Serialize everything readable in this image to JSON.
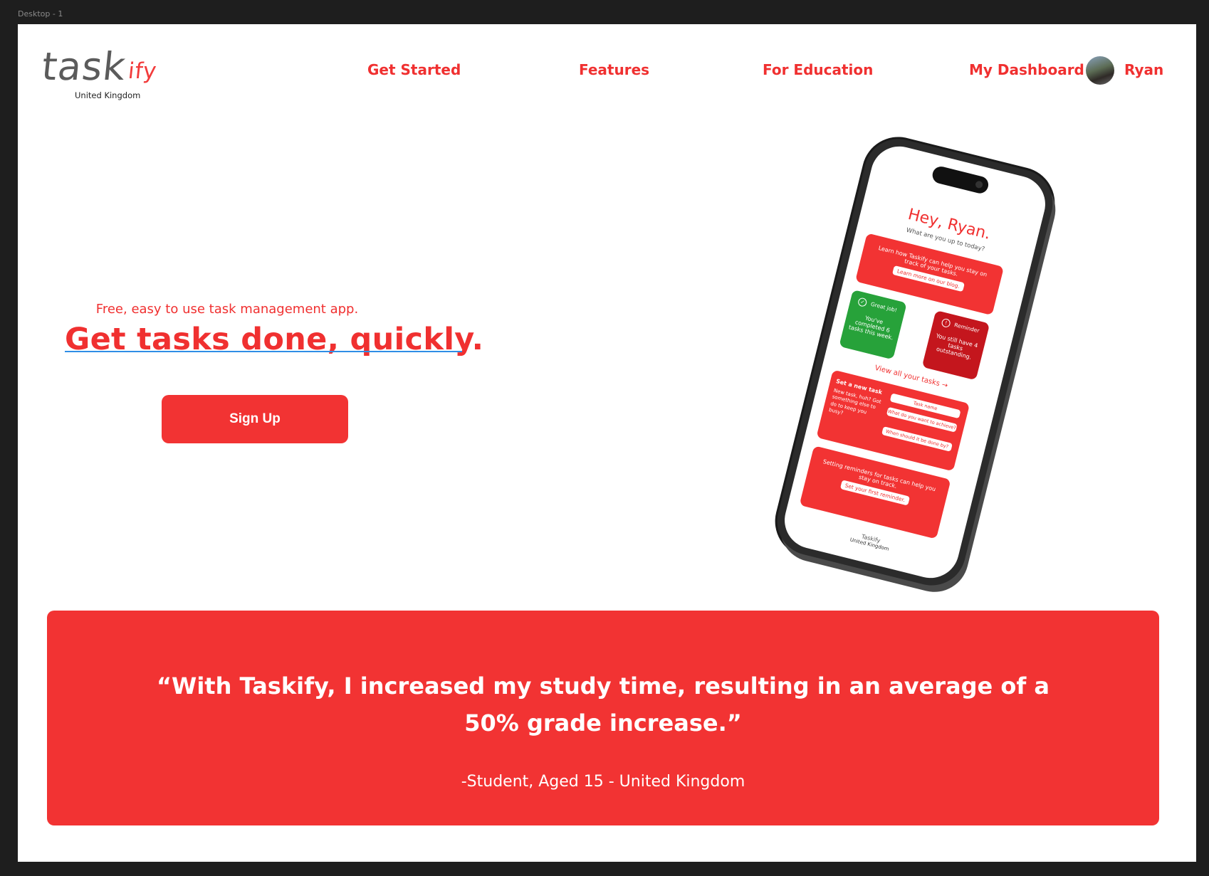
{
  "canvas": {
    "frame_label": "Desktop - 1"
  },
  "logo": {
    "part1": "task",
    "part2": "ify",
    "region": "United Kingdom"
  },
  "nav": {
    "get_started": "Get Started",
    "features": "Features",
    "for_education": "For Education",
    "dashboard": "My Dashboard",
    "user_name": "Ryan"
  },
  "hero": {
    "tagline": "Free, easy to use task management app.",
    "headline": "Get tasks done, quickly.",
    "signup": "Sign Up"
  },
  "phone": {
    "greeting": "Hey, Ryan.",
    "subtitle": "What are you up to today?",
    "learn_text": "Learn how Taskify can help you stay on track of your tasks.",
    "learn_button": "Learn more on our blog.",
    "great_title": "Great job!",
    "great_text": "You've completed 6 tasks this week.",
    "reminder_title": "Reminder",
    "reminder_text": "You still have 4 tasks outstanding.",
    "view_all": "View all your tasks →",
    "new_task_title": "Set a new task",
    "new_task_text": "New task, huh? Got something else to do to keep you busy?",
    "field_name": "Task name",
    "field_goal": "What do you want to achieve?",
    "field_due": "When should it be done by?",
    "reminder_promo": "Setting reminders for tasks can help you stay on track.",
    "reminder_button": "Set your first reminder.",
    "footer_logo": "Taskify",
    "footer_region": "United Kingdom"
  },
  "testimonial": {
    "line1": "“With Taskify, I increased my study time, resulting in an average of a",
    "line2": "50% grade increase.”",
    "attribution": "-Student, Aged 15 - United Kingdom"
  },
  "colors": {
    "brand_red": "#f23333",
    "logo_gray": "#5b5b5b",
    "success_green": "#27a23a",
    "alert_red": "#c4161d"
  }
}
